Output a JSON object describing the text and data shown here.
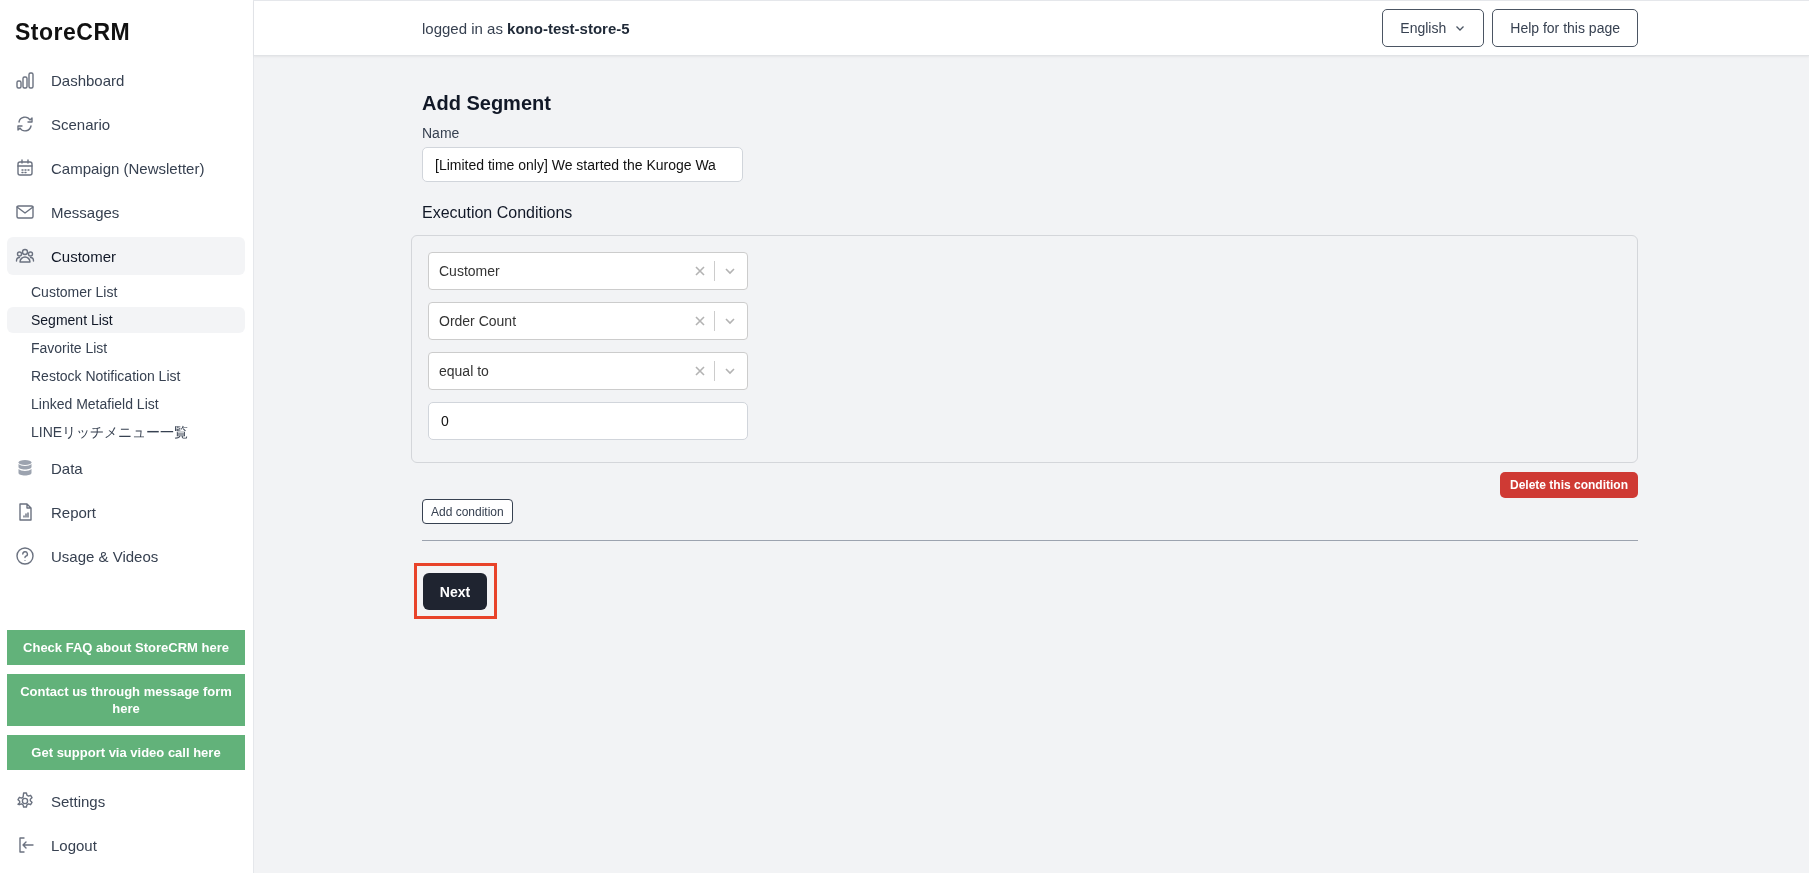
{
  "sidebar": {
    "logo": "StoreCRM",
    "nav": [
      {
        "kind": "dashboard",
        "label": "Dashboard",
        "selected": false
      },
      {
        "kind": "scenario",
        "label": "Scenario",
        "selected": false
      },
      {
        "kind": "calendar",
        "label": "Campaign (Newsletter)",
        "selected": false
      },
      {
        "kind": "messages",
        "label": "Messages",
        "selected": false
      },
      {
        "kind": "customer",
        "label": "Customer",
        "selected": true,
        "expanded": true,
        "children": [
          {
            "label": "Customer List",
            "selected": false
          },
          {
            "label": "Segment List",
            "selected": true
          },
          {
            "label": "Favorite List",
            "selected": false
          },
          {
            "label": "Restock Notification List",
            "selected": false
          },
          {
            "label": "Linked Metafield List",
            "selected": false
          },
          {
            "label": "LINEリッチメニュー一覧",
            "selected": false
          }
        ]
      },
      {
        "kind": "data",
        "label": "Data",
        "selected": false
      },
      {
        "kind": "report",
        "label": "Report",
        "selected": false
      },
      {
        "kind": "help",
        "label": "Usage & Videos",
        "selected": false
      }
    ],
    "support_buttons": [
      "Check FAQ about StoreCRM here",
      "Contact us through message form here",
      "Get support via video call here"
    ],
    "bottom": [
      {
        "kind": "settings",
        "label": "Settings",
        "selected": false
      },
      {
        "kind": "logout",
        "label": "Logout",
        "selected": false
      }
    ]
  },
  "header": {
    "logged_in": "logged in as **kono-test-store-5**",
    "language": "English",
    "help_button": "Help for this page"
  },
  "form": {
    "title": "Add Segment",
    "name_label": "Name",
    "name_value": "[Limited time only] We started the Kuroge Wa",
    "conditions_label": "Execution Conditions",
    "conditions": [
      {
        "kind": "select",
        "value": "Customer"
      },
      {
        "kind": "select",
        "value": "Order Count"
      },
      {
        "kind": "select",
        "value": "equal to"
      },
      {
        "kind": "input",
        "value": "0"
      }
    ],
    "delete_button": "Delete this condition",
    "add_button": "Add condition",
    "next_button": "Next",
    "next_highlighted": true
  }
}
